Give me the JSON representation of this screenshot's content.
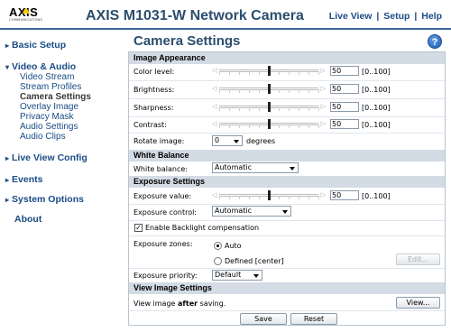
{
  "header": {
    "logo_text": "AXIS",
    "logo_sub": "COMMUNICATIONS",
    "app_title": "AXIS M1031-W Network Camera",
    "nav": [
      "Live View",
      "Setup",
      "Help"
    ]
  },
  "sidebar": {
    "basic_setup": "Basic Setup",
    "video_audio": "Video & Audio",
    "video_audio_items": [
      "Video Stream",
      "Stream Profiles",
      "Camera Settings",
      "Overlay Image",
      "Privacy Mask",
      "Audio Settings",
      "Audio Clips"
    ],
    "live_view_config": "Live View Config",
    "events": "Events",
    "system_options": "System Options",
    "about": "About"
  },
  "main": {
    "title": "Camera Settings",
    "help_icon": "?",
    "image_appearance": {
      "heading": "Image Appearance",
      "color_level": {
        "label": "Color level:",
        "value": "50",
        "range": "[0..100]"
      },
      "brightness": {
        "label": "Brightness:",
        "value": "50",
        "range": "[0..100]"
      },
      "sharpness": {
        "label": "Sharpness:",
        "value": "50",
        "range": "[0..100]"
      },
      "contrast": {
        "label": "Contrast:",
        "value": "50",
        "range": "[0..100]"
      },
      "rotate": {
        "label": "Rotate image:",
        "value": "0",
        "unit": "degrees"
      }
    },
    "white_balance": {
      "heading": "White Balance",
      "label": "White balance:",
      "value": "Automatic"
    },
    "exposure": {
      "heading": "Exposure Settings",
      "value_label": "Exposure value:",
      "value": "50",
      "range": "[0..100]",
      "control_label": "Exposure control:",
      "control_value": "Automatic",
      "backlight_label": "Enable Backlight compensation",
      "backlight_checked": true,
      "zones_label": "Exposure zones:",
      "zone_auto": "Auto",
      "zone_defined": "Defined [center]",
      "edit_button": "Edit...",
      "priority_label": "Exposure priority:",
      "priority_value": "Default"
    },
    "view_image": {
      "heading": "View Image Settings",
      "text_prefix": "View image ",
      "text_bold": "after",
      "text_suffix": " saving.",
      "view_button": "View..."
    },
    "save_button": "Save",
    "reset_button": "Reset"
  }
}
